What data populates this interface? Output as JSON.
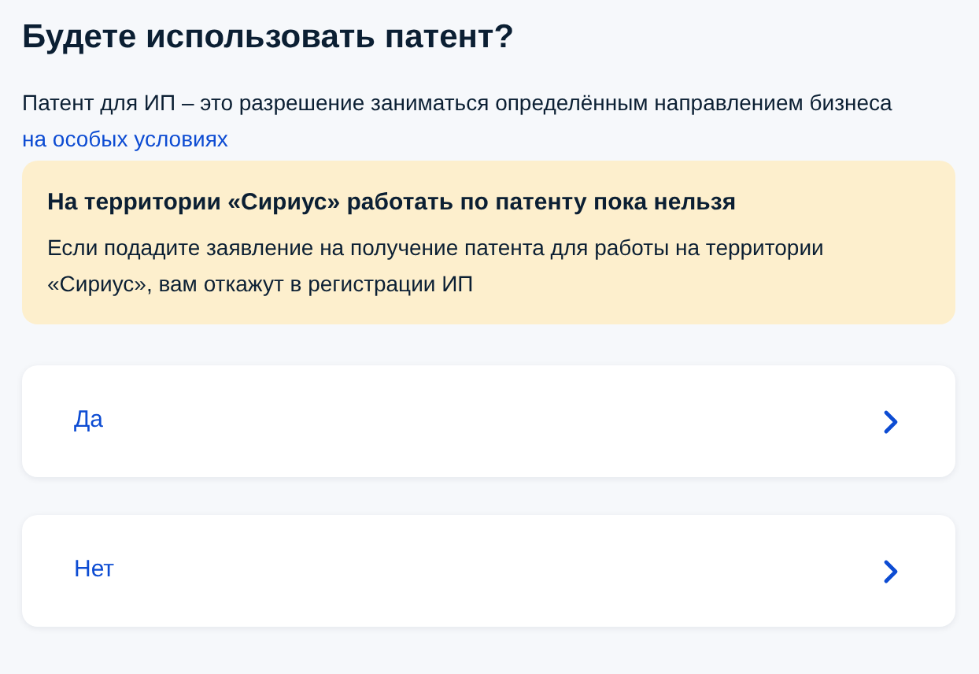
{
  "title": "Будете использовать патент?",
  "description": {
    "text": "Патент для ИП – это разрешение заниматься определённым направлением бизнеса",
    "link": "на особых условиях"
  },
  "warning": {
    "title": "На территории «Сириус» работать по патенту пока нельзя",
    "text": "Если подадите заявление на получение патента для работы на территории «Сириус», вам откажут в регистрации ИП"
  },
  "options": [
    {
      "label": "Да"
    },
    {
      "label": "Нет"
    }
  ]
}
